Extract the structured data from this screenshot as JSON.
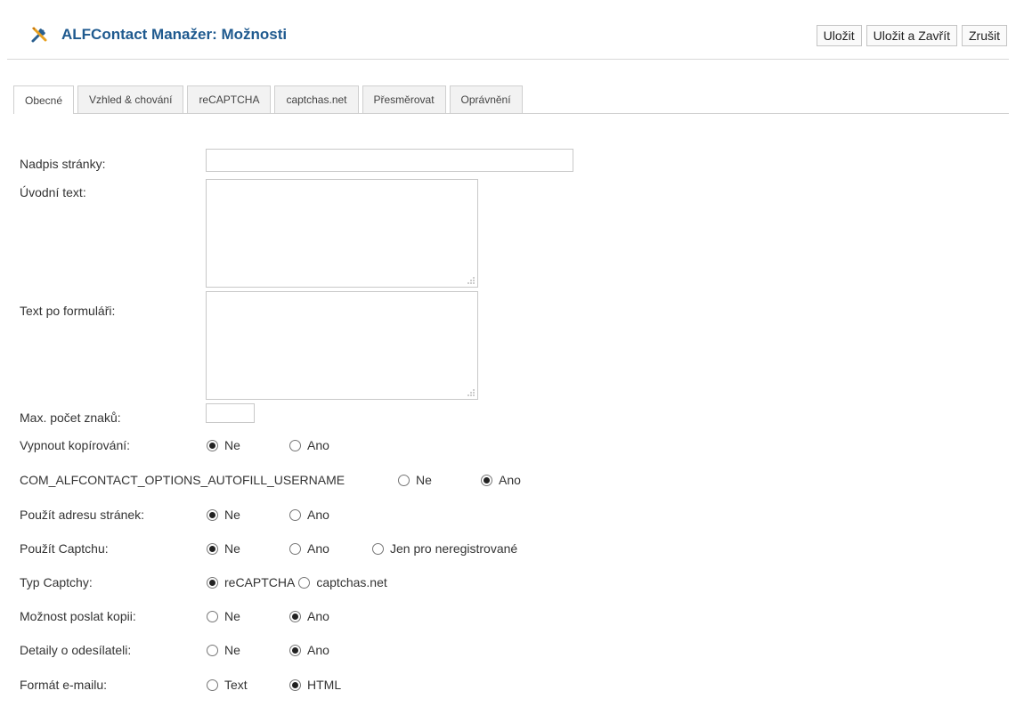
{
  "header": {
    "title": "ALFContact Manažer: Možnosti",
    "icon": "tools-icon",
    "buttons": {
      "save": "Uložit",
      "save_close": "Uložit a Zavřít",
      "cancel": "Zrušit"
    }
  },
  "tabs": [
    {
      "label": "Obecné",
      "active": true
    },
    {
      "label": "Vzhled & chování",
      "active": false
    },
    {
      "label": "reCAPTCHA",
      "active": false
    },
    {
      "label": "captchas.net",
      "active": false
    },
    {
      "label": "Přesměrovat",
      "active": false
    },
    {
      "label": "Oprávnění",
      "active": false
    }
  ],
  "form": {
    "page_heading": {
      "label": "Nadpis stránky:",
      "value": ""
    },
    "intro_text": {
      "label": "Úvodní text:",
      "value": ""
    },
    "after_text": {
      "label": "Text po formuláři:",
      "value": ""
    },
    "max_chars": {
      "label": "Max. počet znaků:",
      "value": ""
    },
    "disable_copy": {
      "label": "Vypnout kopírování:",
      "options": [
        "Ne",
        "Ano"
      ],
      "selected": "Ne"
    },
    "autofill_username": {
      "label": "COM_ALFCONTACT_OPTIONS_AUTOFILL_USERNAME",
      "options": [
        "Ne",
        "Ano"
      ],
      "selected": "Ano"
    },
    "use_site_address": {
      "label": "Použít adresu stránek:",
      "options": [
        "Ne",
        "Ano"
      ],
      "selected": "Ne"
    },
    "use_captcha": {
      "label": "Použít Captchu:",
      "options": [
        "Ne",
        "Ano",
        "Jen pro neregistrované"
      ],
      "selected": "Ne"
    },
    "captcha_type": {
      "label": "Typ Captchy:",
      "options": [
        "reCAPTCHA",
        "captchas.net"
      ],
      "selected": "reCAPTCHA"
    },
    "send_copy": {
      "label": "Možnost poslat kopii:",
      "options": [
        "Ne",
        "Ano"
      ],
      "selected": "Ano"
    },
    "sender_details": {
      "label": "Detaily o odesílateli:",
      "options": [
        "Ne",
        "Ano"
      ],
      "selected": "Ano"
    },
    "email_format": {
      "label": "Formát e-mailu:",
      "options": [
        "Text",
        "HTML"
      ],
      "selected": "HTML"
    }
  },
  "colors": {
    "title": "#1f5a8f",
    "border": "#c8c8c8",
    "tab_bg": "#f2f2f2"
  }
}
